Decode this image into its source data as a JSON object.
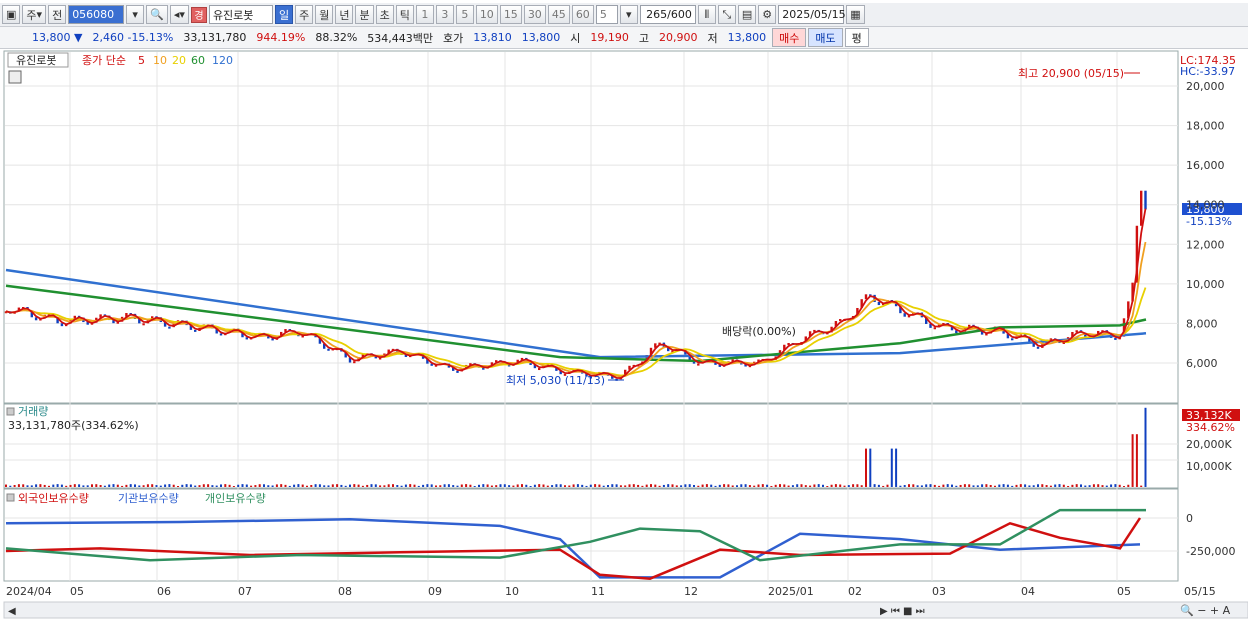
{
  "toolbar1": {
    "period_type": "주",
    "compare": "전",
    "code": "056080",
    "stock_name": "유진로봇",
    "badge": "경",
    "periods": [
      "일",
      "주",
      "월",
      "년",
      "분",
      "초",
      "틱"
    ],
    "selected_period": "일",
    "intervals": [
      "1",
      "3",
      "5",
      "10",
      "15",
      "30",
      "45",
      "60"
    ],
    "custom_interval": "5",
    "bar_count": "265",
    "bar_max": "/600",
    "date": "2025/05/15"
  },
  "toolbar2": {
    "price": "13,800",
    "change_arrow": "▼",
    "change": "2,460",
    "change_pct": "-15.13%",
    "volume": "33,131,780",
    "vol_ratio": "944.19%",
    "pct2": "88.32%",
    "amount": "534,443백만",
    "quote_label": "호가",
    "ask": "13,810",
    "bid": "13,800",
    "open_label": "시",
    "open": "19,190",
    "high_label": "고",
    "high": "20,900",
    "low_label": "저",
    "low": "13,800",
    "buy_label": "매수",
    "sell_label": "매도",
    "eval_label": "평"
  },
  "price_panel": {
    "name_tag": "유진로봇",
    "ma_title": "종가 단순",
    "ma_periods": [
      {
        "label": "5",
        "color": "#d01010"
      },
      {
        "label": "10",
        "color": "#f0a020"
      },
      {
        "label": "20",
        "color": "#e8d000"
      },
      {
        "label": "60",
        "color": "#209030"
      },
      {
        "label": "120",
        "color": "#3070d0"
      }
    ],
    "lc": "LC:174.35",
    "hc": "HC:-33.97",
    "high_annotation": "최고 20,900 (05/15)",
    "low_annotation": "최저 5,030 (11/13)",
    "dividend_annotation": "배당락(0.00%)",
    "current_price_tag": "13,800",
    "current_change_tag": "-15.13%",
    "y_ticks": [
      "20,000",
      "18,000",
      "16,000",
      "14,000",
      "12,000",
      "10,000",
      "8,000",
      "6,000"
    ]
  },
  "volume_panel": {
    "title": "거래량",
    "value": "33,131,780주(334.62%)",
    "tag_value": "33,132K",
    "tag_pct": "334.62%",
    "y_ticks": [
      "20,000K",
      "10,000K"
    ]
  },
  "holdings_panel": {
    "series": [
      {
        "label": "외국인보유수량",
        "color": "#d01010"
      },
      {
        "label": "기관보유수량",
        "color": "#3060d0"
      },
      {
        "label": "개인보유수량",
        "color": "#309060"
      }
    ],
    "y_ticks": [
      "0",
      "-250,000"
    ]
  },
  "x_axis": {
    "labels": [
      "2024/04",
      "05",
      "06",
      "07",
      "08",
      "09",
      "10",
      "11",
      "12",
      "2025/01",
      "02",
      "03",
      "04",
      "05",
      "05/15"
    ]
  },
  "colors": {
    "up": "#d01010",
    "down": "#1040c0",
    "ma5": "#d01010",
    "ma10": "#f0a020",
    "ma20": "#e8d000",
    "ma60": "#209030",
    "ma120": "#3070d0"
  }
}
